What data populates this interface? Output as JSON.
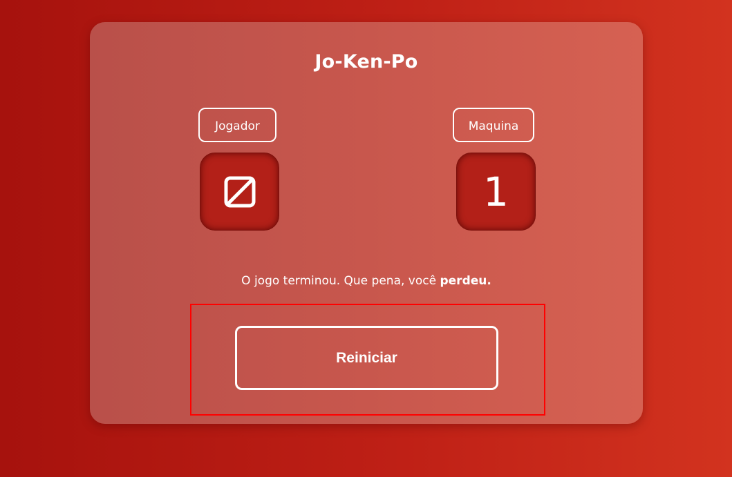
{
  "game": {
    "title": "Jo-Ken-Po",
    "player_label": "Jogador",
    "machine_label": "Maquina",
    "player_choice_icon": "square-slash-icon",
    "machine_choice": "1",
    "result_text": "O jogo terminou. Que pena, você ",
    "result_emphasis": "perdeu.",
    "restart_label": "Reiniciar"
  },
  "colors": {
    "background": "#bf2016",
    "card": "#c8574d",
    "tile": "#b32018",
    "text": "#ffffff",
    "highlight_border": "#ff0000"
  }
}
